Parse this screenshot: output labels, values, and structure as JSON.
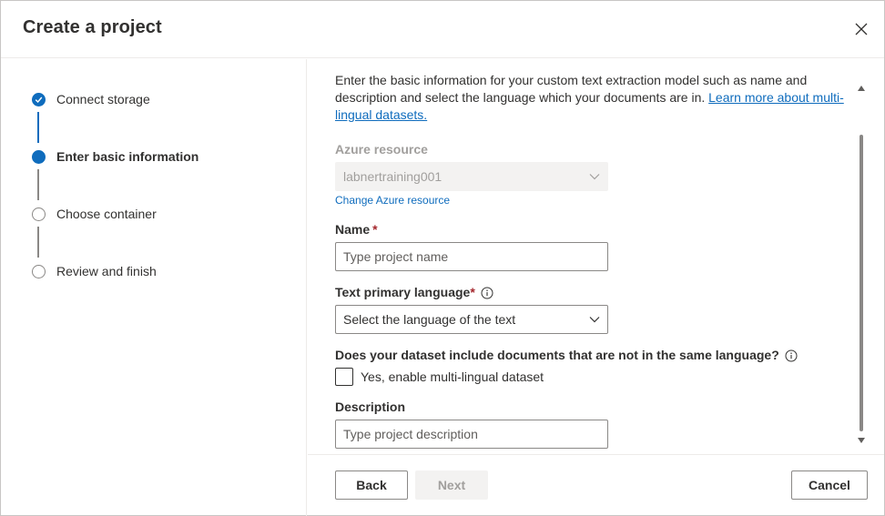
{
  "dialog": {
    "title": "Create a project",
    "close_icon": "close-icon"
  },
  "steps": [
    {
      "label": "Connect storage",
      "state": "completed"
    },
    {
      "label": "Enter basic information",
      "state": "current"
    },
    {
      "label": "Choose container",
      "state": "pending"
    },
    {
      "label": "Review and finish",
      "state": "pending"
    }
  ],
  "form": {
    "intro_text": "Enter the basic information for your custom text extraction model such as name and description and select the language which your documents are in.",
    "intro_link": "Learn more about multi-lingual datasets.",
    "azure_resource": {
      "label": "Azure resource",
      "value": "labnertraining001",
      "change_link": "Change Azure resource"
    },
    "name": {
      "label": "Name",
      "required_mark": "*",
      "placeholder": "Type project name"
    },
    "language": {
      "label": "Text primary language",
      "required_mark": "*",
      "placeholder": "Select the language of the text"
    },
    "multilingual": {
      "question": "Does your dataset include documents that are not in the same language?",
      "checkbox_label": "Yes, enable multi-lingual dataset",
      "checked": false
    },
    "description": {
      "label": "Description",
      "placeholder": "Type project description"
    }
  },
  "footer": {
    "back_label": "Back",
    "next_label": "Next",
    "cancel_label": "Cancel"
  },
  "colors": {
    "accent": "#0f6cbd",
    "required": "#a4262c",
    "disabled_text": "#a19f9d"
  }
}
